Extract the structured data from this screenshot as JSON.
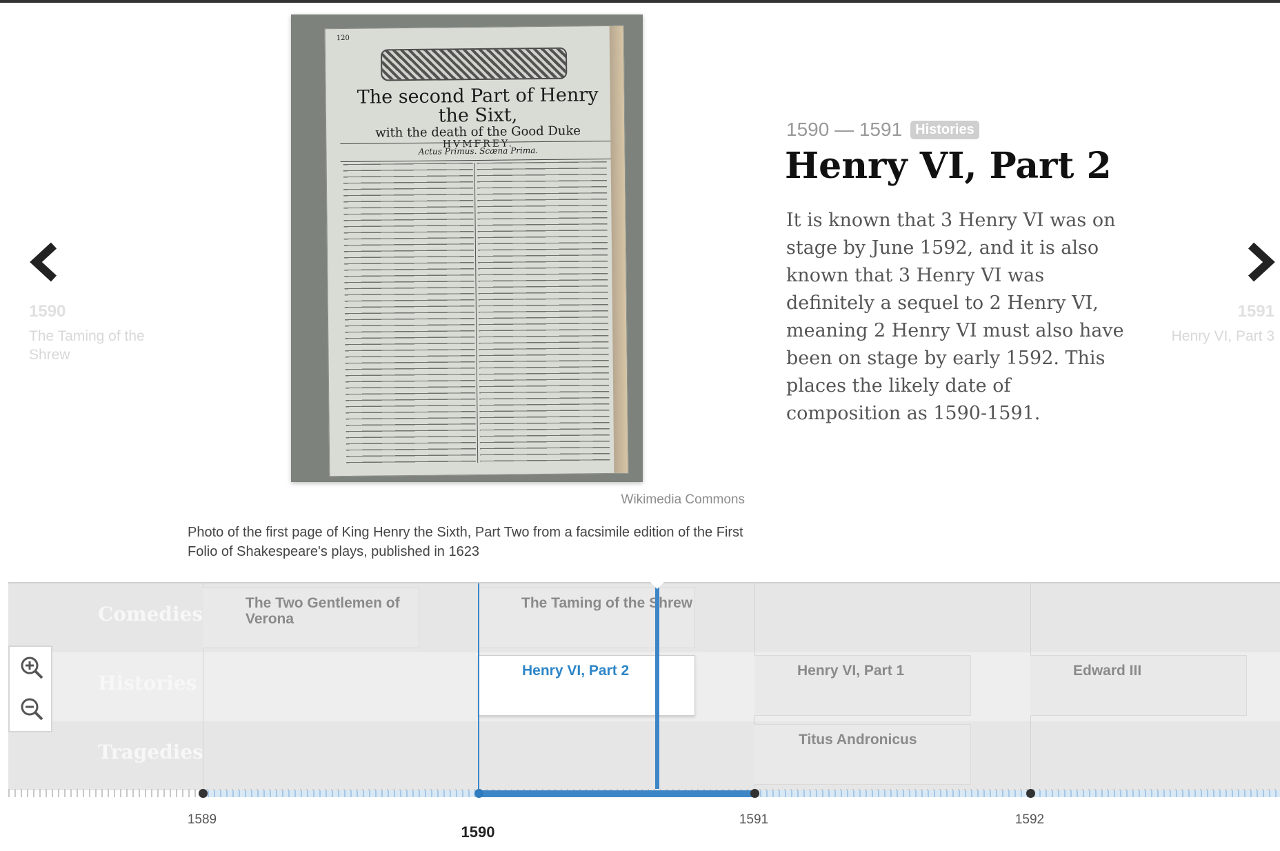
{
  "slide": {
    "folio": {
      "page_number": "120",
      "title_line1": "The second Part of Henry the Sixt,",
      "title_line2": "with the death of the Good Duke",
      "title_line3": "HVMFREY.",
      "act": "Actus Primus.   Scæna Prima."
    },
    "credit": "Wikimedia Commons",
    "caption": "Photo of the first page of King Henry the Sixth, Part Two from a facsimile edition of the First Folio of Shakespeare's plays, published in 1623",
    "dates": "1590 — 1591",
    "category_badge": "Histories",
    "title": "Henry VI, Part 2",
    "body": "It is known that 3 Henry VI was on stage by June 1592, and it is also known that 3 Henry VI was definitely a sequel to 2 Henry VI, meaning 2 Henry VI must also have been on stage by early 1592. This places the likely date of composition as 1590-1591."
  },
  "nav": {
    "prev": {
      "icon": "chevron-left-icon",
      "year": "1590",
      "title": "The Taming of the Shrew"
    },
    "next": {
      "icon": "chevron-right-icon",
      "year": "1591",
      "title": "Henry VI, Part 3"
    }
  },
  "timeline": {
    "rows": [
      "Comedies",
      "Histories",
      "Tragedies"
    ],
    "events": {
      "two_gentlemen": "The Two Gentlemen of Verona",
      "taming": "The Taming of the Shrew",
      "henry6_2": "Henry VI, Part 2",
      "henry6_1": "Henry VI, Part 1",
      "edward3": "Edward III",
      "titus": "Titus Andronicus"
    },
    "zoom_in_icon": "zoom-in-icon",
    "zoom_out_icon": "zoom-out-icon",
    "ticks": {
      "t1589": "1589",
      "t1590": "1590",
      "t1591": "1591",
      "t1592": "1592"
    }
  },
  "colors": {
    "accent": "#3d86c6",
    "active_text": "#2e86c8",
    "badge": "#cfcfcf"
  }
}
